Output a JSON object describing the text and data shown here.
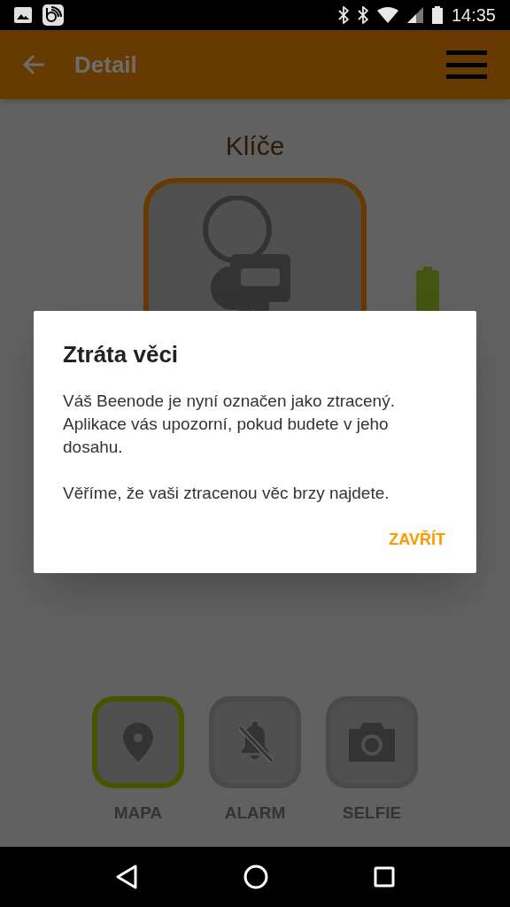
{
  "status_bar": {
    "time": "14:35"
  },
  "app_bar": {
    "title": "Detail"
  },
  "item": {
    "name": "Klíče"
  },
  "actions": [
    {
      "label": "MAPA",
      "kind": "map",
      "selected": true
    },
    {
      "label": "ALARM",
      "kind": "alarm",
      "selected": false
    },
    {
      "label": "SELFIE",
      "kind": "selfie",
      "selected": false
    }
  ],
  "dialog": {
    "title": "Ztráta věci",
    "paragraphs": [
      "Váš Beenode je nyní označen jako ztracený. Aplikace vás upozorní, pokud budete v jeho dosahu.",
      "Věříme, že vaši ztracenou věc brzy najdete."
    ],
    "button": "ZAVŘÍT"
  }
}
